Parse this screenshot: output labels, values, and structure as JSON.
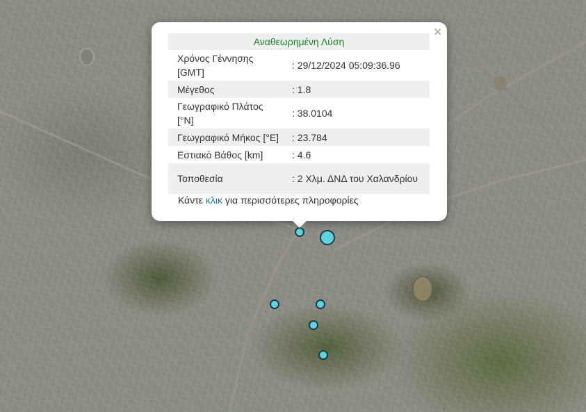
{
  "popup": {
    "title": "Αναθεωρημένη Λύση",
    "close_symbol": "×",
    "rows": [
      {
        "label": "Χρόνος Γέννησης [GMT]",
        "value": ": 29/12/2024 05:09:36.96"
      },
      {
        "label": "Μέγεθος",
        "value": ": 1.8"
      },
      {
        "label": "Γεωγραφικό Πλάτος [°N]",
        "value": ": 38.0104"
      },
      {
        "label": "Γεωγραφικό Μήκος [°E]",
        "value": ": 23.784"
      },
      {
        "label": "Εστιακό Βάθος [km]",
        "value": ": 4.6"
      },
      {
        "label": "Τοποθεσία",
        "value": ": 2 Χλμ. ΔΝΔ του Χαλανδρίου"
      }
    ],
    "more_prefix": "Κάντε ",
    "more_link": "κλικ",
    "more_suffix": " για περισσότερες πληροφορίες"
  },
  "map": {
    "marker_color": "#5ed4e2",
    "marker_border": "#1b3b45",
    "marker_count": 6
  }
}
